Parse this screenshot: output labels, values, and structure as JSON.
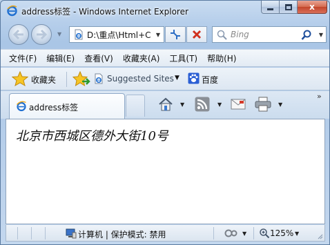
{
  "window": {
    "title": "address标签 - Windows Internet Explorer",
    "controls": {
      "minimize": "",
      "maximize": "",
      "close": "x"
    }
  },
  "address_bar": {
    "url": "D:\\重点\\Html+C",
    "search_placeholder": "Bing"
  },
  "menu": {
    "items": [
      "文件(F)",
      "编辑(E)",
      "查看(V)",
      "收藏夹(A)",
      "工具(T)",
      "帮助(H)"
    ]
  },
  "favorites_bar": {
    "favorites_label": "收藏夹",
    "suggested_sites_label": "Suggested Sites",
    "baidu_label": "百度"
  },
  "tabs": [
    {
      "label": "address标签",
      "active": true
    }
  ],
  "toolbar": {
    "chevron": "»"
  },
  "page": {
    "address_text": "北京市西城区德外大街10号"
  },
  "status_bar": {
    "zone_text": "计算机 | 保护模式: 禁用",
    "zoom": "125%"
  },
  "colors": {
    "frame": "#b7cfeb",
    "close_button": "#c2452a",
    "content_bg": "#ffffff"
  }
}
